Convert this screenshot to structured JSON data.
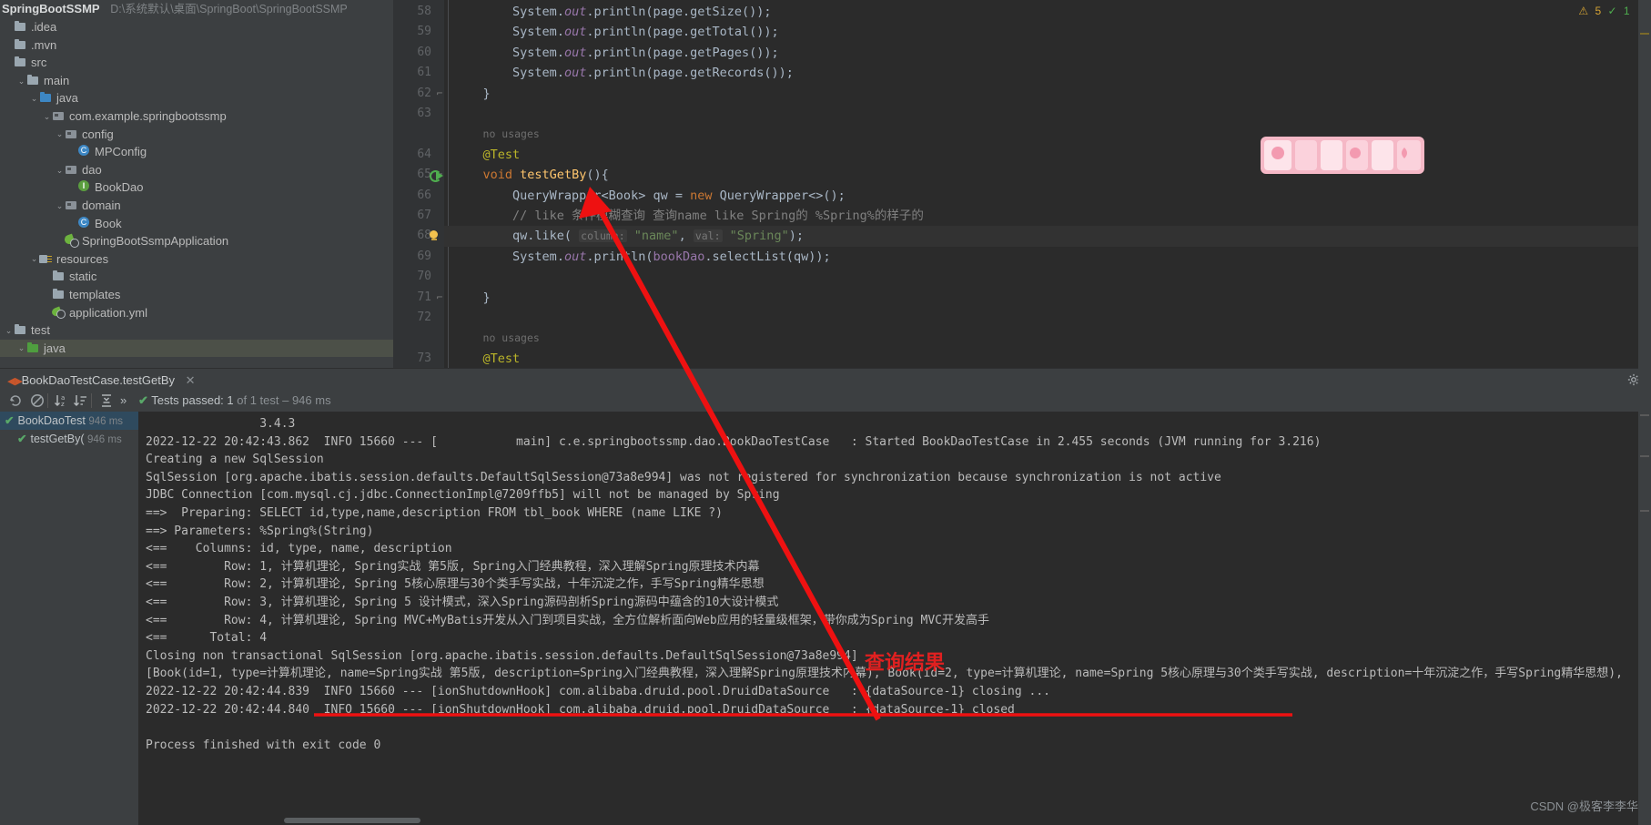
{
  "project": {
    "name": "SpringBootSSMP",
    "path": "D:\\系统默认\\桌面\\SpringBoot\\SpringBootSSMP",
    "items": [
      {
        "label": ".idea",
        "indent": 0,
        "arrow": "",
        "icon": "folder-icon",
        "selected": false
      },
      {
        "label": ".mvn",
        "indent": 0,
        "arrow": "",
        "icon": "folder-icon",
        "selected": false
      },
      {
        "label": "src",
        "indent": 0,
        "arrow": "",
        "icon": "folder-icon",
        "selected": false
      },
      {
        "label": "main",
        "indent": 1,
        "arrow": "⌄",
        "icon": "folder-icon",
        "selected": false
      },
      {
        "label": "java",
        "indent": 2,
        "arrow": "⌄",
        "icon": "folder-blue-icon",
        "selected": false
      },
      {
        "label": "com.example.springbootssmp",
        "indent": 3,
        "arrow": "⌄",
        "icon": "package-icon",
        "selected": false
      },
      {
        "label": "config",
        "indent": 4,
        "arrow": "⌄",
        "icon": "package-icon",
        "selected": false
      },
      {
        "label": "MPConfig",
        "indent": 5,
        "arrow": "",
        "icon": "java-class-icon",
        "selected": false
      },
      {
        "label": "dao",
        "indent": 4,
        "arrow": "⌄",
        "icon": "package-icon",
        "selected": false
      },
      {
        "label": "BookDao",
        "indent": 5,
        "arrow": "",
        "icon": "java-interface-icon",
        "selected": false
      },
      {
        "label": "domain",
        "indent": 4,
        "arrow": "⌄",
        "icon": "package-icon",
        "selected": false
      },
      {
        "label": "Book",
        "indent": 5,
        "arrow": "",
        "icon": "java-class-icon",
        "selected": false
      },
      {
        "label": "SpringBootSsmpApplication",
        "indent": 4,
        "arrow": "",
        "icon": "spring-boot-icon",
        "selected": false
      },
      {
        "label": "resources",
        "indent": 2,
        "arrow": "⌄",
        "icon": "resources-folder-icon",
        "selected": false
      },
      {
        "label": "static",
        "indent": 3,
        "arrow": "",
        "icon": "folder-icon",
        "selected": false
      },
      {
        "label": "templates",
        "indent": 3,
        "arrow": "",
        "icon": "folder-icon",
        "selected": false
      },
      {
        "label": "application.yml",
        "indent": 3,
        "arrow": "",
        "icon": "spring-yaml-icon",
        "selected": false
      },
      {
        "label": "test",
        "indent": 0,
        "arrow": "⌄",
        "icon": "folder-icon",
        "selected": false
      },
      {
        "label": "java",
        "indent": 1,
        "arrow": "⌄",
        "icon": "folder-green-icon",
        "selected": true
      }
    ]
  },
  "editor": {
    "status": {
      "warning_count": "5",
      "ok_count": "1",
      "error_count": "",
      "warn_icon": "warning-triangle-icon",
      "ok_icon": "checkmark-icon",
      "chevron": "⌄"
    },
    "lines": [
      {
        "num": "58",
        "html": "        <span class='typ'>System</span>.<span class='stc'>out</span>.println(page.getSize());"
      },
      {
        "num": "59",
        "html": "        <span class='typ'>System</span>.<span class='stc'>out</span>.println(page.getTotal());"
      },
      {
        "num": "60",
        "html": "        <span class='typ'>System</span>.<span class='stc'>out</span>.println(page.getPages());"
      },
      {
        "num": "61",
        "html": "        <span class='typ'>System</span>.<span class='stc'>out</span>.println(page.getRecords());"
      },
      {
        "num": "62",
        "html": "    }",
        "fold": "⊟"
      },
      {
        "num": "63",
        "html": ""
      },
      {
        "num": "",
        "html": "    <span class='usg'>no usages</span>"
      },
      {
        "num": "64",
        "html": "    <span class='ann'>@Test</span>"
      },
      {
        "num": "65",
        "html": "    <span class='kw'>void</span> <span class='mth'>testGetBy</span>(){",
        "fold": "⊟",
        "run": true
      },
      {
        "num": "66",
        "html": "        QueryWrapper&lt;Book&gt; qw = <span class='kw'>new</span> QueryWrapper&lt;&gt;();"
      },
      {
        "num": "67",
        "html": "        <span class='cmt'>// like 条件模糊查询 查询name like Spring的 %Spring%的样子的</span>"
      },
      {
        "num": "68",
        "html": "        qw.like( <span class='hint'>column:</span> <span class='str'>\"name\"</span>, <span class='hint'>val:</span> <span class='str'>\"Spring\"</span>);",
        "bulb": true,
        "current": true
      },
      {
        "num": "69",
        "html": "        <span class='typ'>System</span>.<span class='stc'>out</span>.println(<span class='fld'>bookDao</span>.selectList(qw));"
      },
      {
        "num": "70",
        "html": ""
      },
      {
        "num": "71",
        "html": "    }",
        "fold": "⊟"
      },
      {
        "num": "72",
        "html": ""
      },
      {
        "num": "",
        "html": "    <span class='usg'>no usages</span>"
      },
      {
        "num": "73",
        "html": "    <span class='ann'>@Test</span>"
      }
    ]
  },
  "run_tab": {
    "icon": "run-test-icon",
    "title": "BookDaoTestCase.testGetBy",
    "close_icon": "close-icon",
    "settings_icon": "gear-icon"
  },
  "test_toolbar": {
    "icons": [
      {
        "name": "rerun-icon",
        "glyph": "↺"
      },
      {
        "name": "rerun-failed-icon",
        "glyph": "⊘"
      },
      {
        "name": "sort-alphabetically-icon",
        "glyph": "↓ᴀ"
      },
      {
        "name": "sort-by-duration-icon",
        "glyph": "↓≡"
      },
      {
        "name": "expand-collapse-icon",
        "glyph": "⇳"
      },
      {
        "name": "more-options-icon",
        "glyph": "»"
      }
    ],
    "status_check": "✔",
    "status_label": "Tests passed: ",
    "passed_count": "1",
    "status_suffix": " of 1 test – 946 ms"
  },
  "test_tree": [
    {
      "label": "BookDaoTest",
      "duration": "946 ms",
      "indent": 0,
      "selected": true,
      "status_icon": "check-icon"
    },
    {
      "label": "testGetBy(",
      "duration": "946 ms",
      "indent": 1,
      "selected": false,
      "status_icon": "check-icon"
    }
  ],
  "console": {
    "lines": [
      "                3.4.3",
      "2022-12-22 20:42:43.862  INFO 15660 --- [           main] c.e.springbootssmp.dao.BookDaoTestCase   : Started BookDaoTestCase in 2.455 seconds (JVM running for 3.216)",
      "Creating a new SqlSession",
      "SqlSession [org.apache.ibatis.session.defaults.DefaultSqlSession@73a8e994] was not registered for synchronization because synchronization is not active",
      "JDBC Connection [com.mysql.cj.jdbc.ConnectionImpl@7209ffb5] will not be managed by Spring",
      "==>  Preparing: SELECT id,type,name,description FROM tbl_book WHERE (name LIKE ?)",
      "==> Parameters: %Spring%(String)",
      "<==    Columns: id, type, name, description",
      "<==        Row: 1, 计算机理论, Spring实战 第5版, Spring入门经典教程，深入理解Spring原理技术内幕",
      "<==        Row: 2, 计算机理论, Spring 5核心原理与30个类手写实战，十年沉淀之作，手写Spring精华思想",
      "<==        Row: 3, 计算机理论, Spring 5 设计模式，深入Spring源码剖析Spring源码中蕴含的10大设计模式",
      "<==        Row: 4, 计算机理论, Spring MVC+MyBatis开发从入门到项目实战，全方位解析面向Web应用的轻量级框架，带你成为Spring MVC开发高手",
      "<==      Total: 4",
      "Closing non transactional SqlSession [org.apache.ibatis.session.defaults.DefaultSqlSession@73a8e994]",
      "[Book(id=1, type=计算机理论, name=Spring实战 第5版, description=Spring入门经典教程，深入理解Spring原理技术内幕), Book(id=2, type=计算机理论, name=Spring 5核心原理与30个类手写实战, description=十年沉淀之作，手写Spring精华思想),",
      "2022-12-22 20:42:44.839  INFO 15660 --- [ionShutdownHook] com.alibaba.druid.pool.DruidDataSource   : {dataSource-1} closing ...",
      "2022-12-22 20:42:44.840  INFO 15660 --- [ionShutdownHook] com.alibaba.druid.pool.DruidDataSource   : {dataSource-1} closed",
      "",
      "Process finished with exit code 0"
    ]
  },
  "annotation": {
    "label": "查询结果",
    "color": "#e02020",
    "arrow_name": "red-arrow-annotation",
    "underline_name": "red-underline-annotation"
  },
  "watermark": "CSDN @极客李李华",
  "colors": {
    "editor_bg": "#2b2b2b",
    "panel_bg": "#3c3f41",
    "accent_green": "#59a869",
    "accent_orange": "#cc7832",
    "string_green": "#6a8759",
    "annotation_red": "#e02020",
    "selection_blue": "#2f4a5e"
  }
}
